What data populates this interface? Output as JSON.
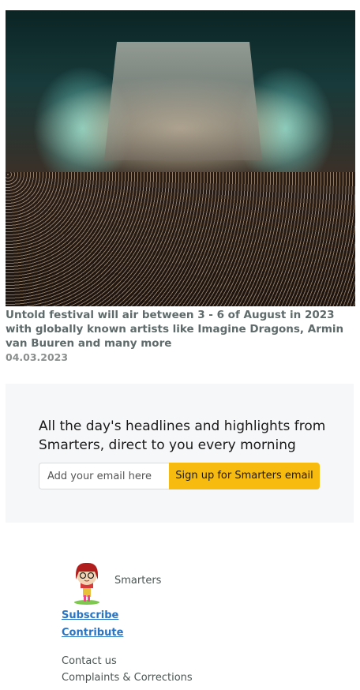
{
  "article": {
    "caption": "Untold festival will air between 3 - 6 of August in 2023 with globally known artists like Imagine Dragons, Armin van Buuren and many more",
    "date": "04.03.2023"
  },
  "newsletter": {
    "heading": "All the day's headlines and highlights from Smarters, direct to you every morning",
    "email_placeholder": "Add your email here",
    "signup_label": "Sign up for Smarters email",
    "accent_color": "#f7bb10"
  },
  "footer": {
    "brand": "Smarters",
    "links": [
      "Subscribe",
      "Contribute"
    ],
    "texts": [
      "Contact us",
      "Complaints & Corrections"
    ]
  }
}
